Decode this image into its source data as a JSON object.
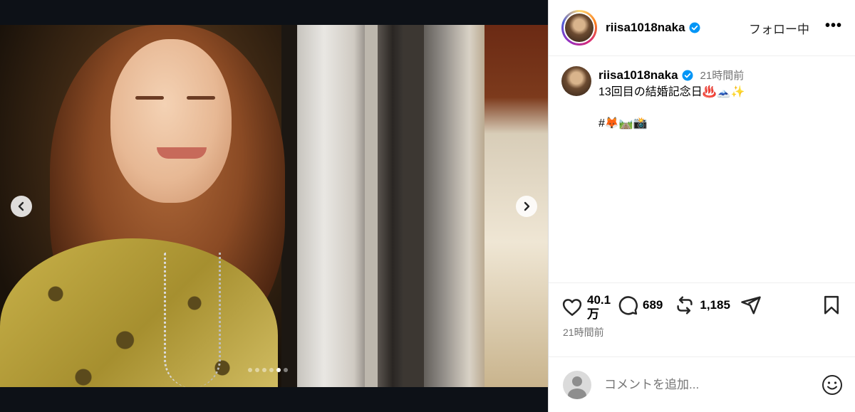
{
  "post": {
    "username": "riisa1018naka",
    "follow_label": "フォロー中",
    "more_label": "•••",
    "caption": {
      "username": "riisa1018naka",
      "time": "21時間前",
      "text": "13回目の結婚記念日♨️🗻✨",
      "tags": "#🦊🛤️📸"
    },
    "actions": {
      "likes": "40.1万",
      "comments": "689",
      "reposts": "1,185"
    },
    "timestamp": "21時間前",
    "comment_placeholder": "コメントを追加...",
    "carousel": {
      "total": 6,
      "active_index": 4
    }
  },
  "icons": {
    "prev": "chevron-left-icon",
    "next": "chevron-right-icon",
    "verified": "verified-badge-icon",
    "like": "heart-icon",
    "comment": "comment-bubble-icon",
    "repost": "repost-icon",
    "share": "paper-plane-icon",
    "save": "bookmark-icon",
    "emoji": "smiley-icon"
  },
  "colors": {
    "verified": "#0095f6",
    "muted_text": "#737373",
    "border": "#dbdbdb",
    "media_bg": "#0d1117"
  }
}
